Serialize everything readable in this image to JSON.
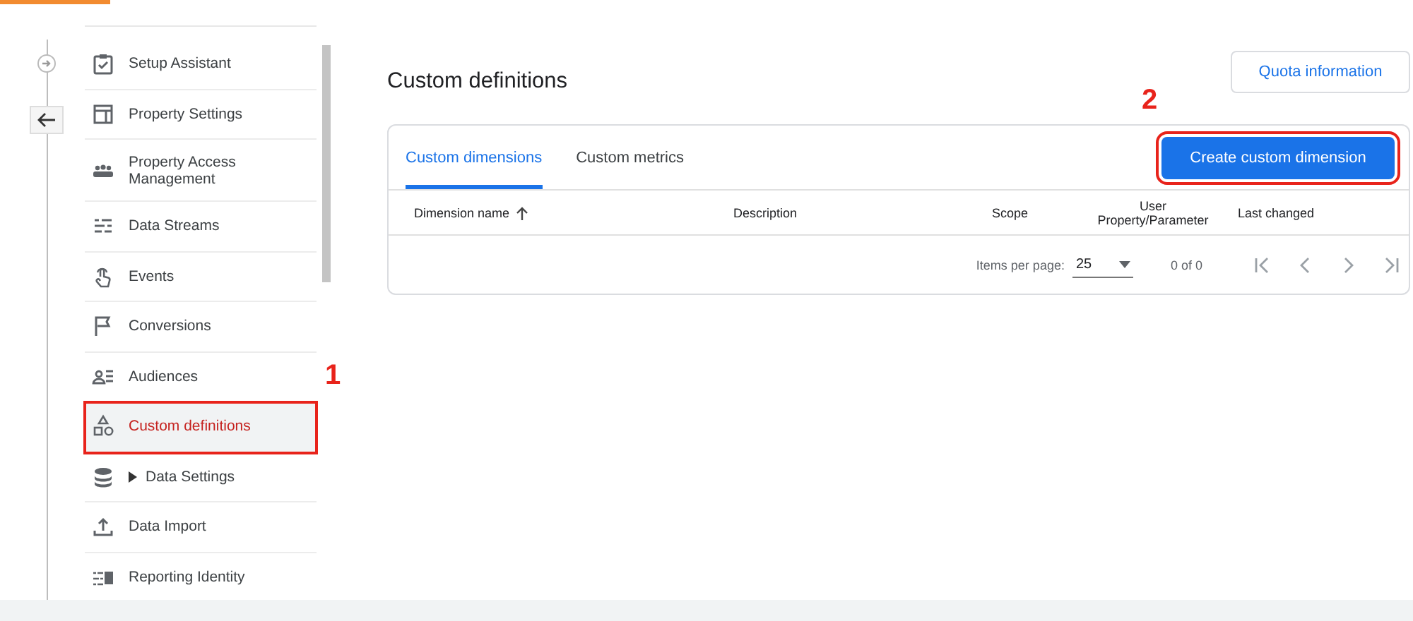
{
  "sidebar": {
    "items": [
      {
        "label": "Setup Assistant",
        "kind": "link",
        "selected": false,
        "highlighted": false
      },
      {
        "label": "Property Settings",
        "kind": "link",
        "selected": false,
        "highlighted": false
      },
      {
        "label": "Property Access Management",
        "kind": "link",
        "selected": false,
        "highlighted": false
      },
      {
        "label": "Data Streams",
        "kind": "link",
        "selected": false,
        "highlighted": false
      },
      {
        "label": "Events",
        "kind": "link",
        "selected": false,
        "highlighted": false
      },
      {
        "label": "Conversions",
        "kind": "link",
        "selected": false,
        "highlighted": false
      },
      {
        "label": "Audiences",
        "kind": "link",
        "selected": false,
        "highlighted": false
      },
      {
        "label": "Custom definitions",
        "kind": "link",
        "selected": true,
        "highlighted": true
      },
      {
        "label": "Data Settings",
        "kind": "group",
        "expanded": false,
        "selected": false,
        "highlighted": false
      },
      {
        "label": "Data Import",
        "kind": "link",
        "selected": false,
        "highlighted": false
      },
      {
        "label": "Reporting Identity",
        "kind": "link",
        "selected": false,
        "highlighted": false
      }
    ]
  },
  "annotations": [
    {
      "label": "1"
    },
    {
      "label": "2"
    }
  ],
  "page": {
    "title": "Custom definitions",
    "quota_button": "Quota information",
    "tabs": [
      {
        "label": "Custom dimensions",
        "selected": true
      },
      {
        "label": "Custom metrics",
        "selected": false
      }
    ],
    "create_button": {
      "label": "Create custom dimension",
      "highlighted": true
    },
    "table": {
      "columns": [
        {
          "label": "Dimension name",
          "sorted": true
        },
        {
          "label": "Description",
          "sorted": false
        },
        {
          "label": "Scope",
          "sorted": false
        },
        {
          "label": "User Property/Parameter",
          "sorted": false
        },
        {
          "label": "Last changed",
          "sorted": false
        }
      ]
    },
    "pagination": {
      "items_per_page_label": "Items per page:",
      "items_per_page": "25",
      "range": "0 of 0"
    }
  }
}
